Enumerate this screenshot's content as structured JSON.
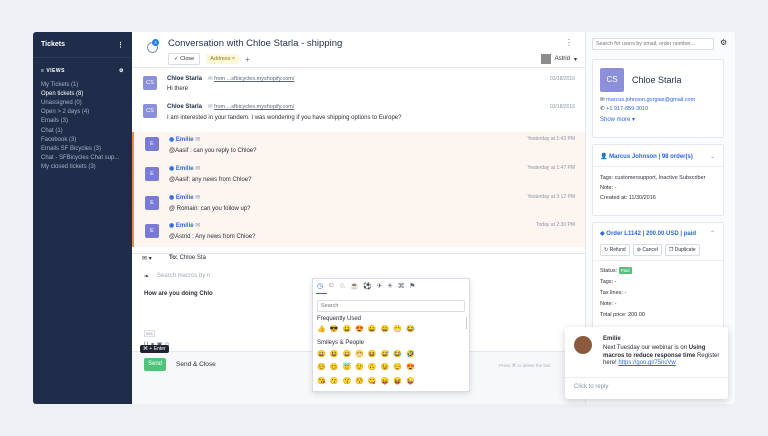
{
  "sidebar": {
    "title": "Tickets",
    "views_label": "VIEWS",
    "items": [
      {
        "label": "My Tickets (1)"
      },
      {
        "label": "Open tickets (8)"
      },
      {
        "label": "Unassigned (0)"
      },
      {
        "label": "Open > 2 days (4)"
      },
      {
        "label": "Emails (3)"
      },
      {
        "label": "Chat (1)"
      },
      {
        "label": "Facebook (3)"
      },
      {
        "label": "Emails SF Bicycles (3)"
      },
      {
        "label": "Chat - SFBicycles Chat sup..."
      },
      {
        "label": "My closed tickets (3)"
      }
    ]
  },
  "header": {
    "badge": "3",
    "title": "Conversation with Chloe Starla - shipping",
    "close_label": "✓ Close",
    "address_tag": "Address ×",
    "add_tag": "+",
    "assignee": "Astrid"
  },
  "messages": [
    {
      "avatar": "CS",
      "sender": "Chloe Starla",
      "from": "from ...sfbicycles.myshopify.com/",
      "text": "Hi there",
      "time": "03/18/2016"
    },
    {
      "avatar": "CS",
      "sender": "Chloe Starla",
      "from": "from ...sfbicycles.myshopify.com/",
      "text": "I am interested in your tandem. I was wondering if you have shipping options to Europe?",
      "time": "03/18/2016"
    },
    {
      "avatar": "E",
      "sender": "Emilie",
      "text": "@Aasif : can you reply to Chloe?",
      "time": "Yesterday at 1:43 PM"
    },
    {
      "avatar": "E",
      "sender": "Emilie",
      "text": "@Aasif: any news from Chloe?",
      "time": "Yesterday at 1:47 PM"
    },
    {
      "avatar": "E",
      "sender": "Emilie",
      "text": "@ Romain: can you follow up?",
      "time": "Yesterday at 3:12 PM"
    },
    {
      "avatar": "E",
      "sender": "Emilie",
      "text": "@Astrid : Any news from Chloe?",
      "time": "Today at 2:30 PM"
    }
  ],
  "reply": {
    "to_label": "To:",
    "to_value": "Chloe Sta",
    "macros_placeholder": "Search macros by n",
    "body": "How are you doing Chlo",
    "enter_tip": "⌘ + Enter",
    "send_label": "Send",
    "send_close_label": "Send & Close",
    "hint": "Press ⌘ to delete the last"
  },
  "emoji_picker": {
    "search_placeholder": "Search",
    "section_frequent": "Frequently Used",
    "section_smileys": "Smileys & People",
    "frequent": [
      "👍",
      "😎",
      "😀",
      "😍",
      "😀",
      "😄",
      "😁",
      "😂"
    ],
    "smileys_1": [
      "😀",
      "😃",
      "😄",
      "😁",
      "😆",
      "😅",
      "😂",
      "🤣"
    ],
    "smileys_2": [
      "☺️",
      "😊",
      "😇",
      "🙂",
      "🙃",
      "😉",
      "😌",
      "😍"
    ],
    "smileys_3": [
      "😘",
      "😗",
      "😙",
      "😚",
      "😋",
      "😛",
      "😝",
      "😜"
    ]
  },
  "right_panel": {
    "search_placeholder": "Search for users by email, order number...",
    "customer": {
      "initials": "CS",
      "name": "Chloe Starla",
      "email": "marcus.johnson.gorgias@gmail.com",
      "phone": "+1 917-859-3010",
      "show_more": "Show more ▾"
    },
    "shop": {
      "title": "Marcus Johnson | 98 order(s)",
      "tags": "Tags: customersupport, Inactive Subscriber",
      "note": "Note: -",
      "created": "Created at: 11/30/2016"
    },
    "order": {
      "title": "Order L1142 | 200.00 USD | paid",
      "refund": "Refund",
      "cancel": "Cancel",
      "duplicate": "Duplicate",
      "status_label": "Status:",
      "status_value": "Paid",
      "tags": "Tags: -",
      "tax_lines": "Tax lines: -",
      "note": "Note: -",
      "total": "Total price: 200.00"
    }
  },
  "chat_widget": {
    "name": "Emilie",
    "message_pre": "Next Tuesday our webinar is on ",
    "message_bold": "Using macros to reduce response time",
    "message_post": " Register here! ",
    "link": "https://goo.gl/75ncVw",
    "reply_placeholder": "Click to reply"
  }
}
